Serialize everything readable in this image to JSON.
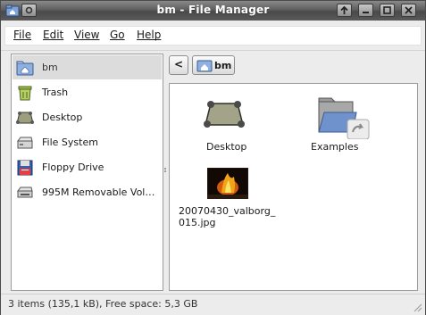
{
  "window": {
    "title": "bm - File Manager"
  },
  "menu": [
    {
      "label": "File"
    },
    {
      "label": "Edit"
    },
    {
      "label": "View"
    },
    {
      "label": "Go"
    },
    {
      "label": "Help"
    }
  ],
  "sidebar": {
    "items": [
      {
        "label": "bm",
        "icon": "home-folder-icon",
        "selected": true
      },
      {
        "label": "Trash",
        "icon": "trash-icon"
      },
      {
        "label": "Desktop",
        "icon": "desktop-icon"
      },
      {
        "label": "File System",
        "icon": "harddisk-icon"
      },
      {
        "label": "Floppy Drive",
        "icon": "floppy-icon"
      },
      {
        "label": "995M Removable Vol…",
        "icon": "removable-drive-icon"
      }
    ]
  },
  "pathbar": {
    "back_label": "<",
    "current": "bm"
  },
  "files": [
    {
      "name": "Desktop",
      "icon": "desktop-icon"
    },
    {
      "name": "Examples",
      "icon": "folder-link-icon"
    },
    {
      "name_line1": "20070430_valborg_",
      "name_line2": "015.jpg",
      "icon": "image-thumbnail"
    }
  ],
  "status": {
    "text": "3 items (135,1 kB), Free space: 5,3 GB"
  },
  "colors": {
    "titlebar": "#5e5e5e",
    "folder_blue": "#6d8fc9",
    "selection": "#dcdcdc"
  }
}
